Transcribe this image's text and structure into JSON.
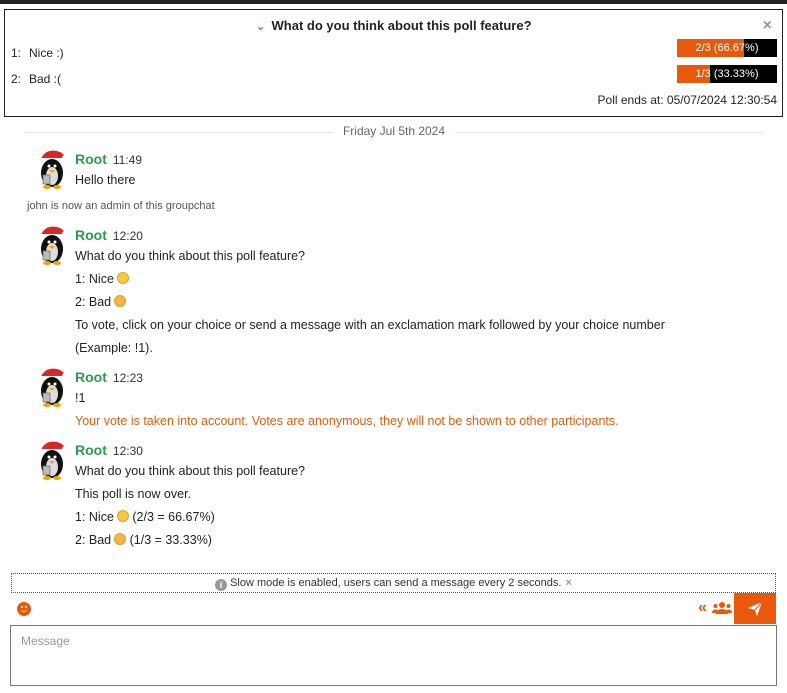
{
  "poll": {
    "question": "What do you think about this poll feature?",
    "choices": [
      {
        "num": "1:",
        "label": "Nice :)",
        "bar_label": "2/3 (66.67%)",
        "fraction": 0.6667
      },
      {
        "num": "2:",
        "label": "Bad :(",
        "bar_label": "1/3 (33.33%)",
        "fraction": 0.3333
      }
    ],
    "ends": "Poll ends at: 05/07/2024 12:30:54",
    "close_glyph": "×"
  },
  "date_separator": "Friday Jul 5th 2024",
  "system_note": "john is now an admin of this groupchat",
  "messages": [
    {
      "author": "Root",
      "time": "11:49",
      "lines": [
        "Hello there"
      ]
    },
    {
      "author": "Root",
      "time": "12:20",
      "lines": [
        "What do you think about this poll feature?",
        "1: Nice",
        "2: Bad",
        "To vote, click on your choice or send a message with an exclamation mark followed by your choice number",
        "(Example: !1)."
      ]
    },
    {
      "author": "Root",
      "time": "12:23",
      "lines": [
        "!1"
      ],
      "notice": "Your vote is taken into account. Votes are anonymous, they will not be shown to other participants."
    },
    {
      "author": "Root",
      "time": "12:30",
      "lines": [
        "What do you think about this poll feature?",
        "This poll is now over.",
        "1: Nice",
        "2: Bad"
      ],
      "results": [
        "(2/3 = 66.67%)",
        "(1/3 = 33.33%)"
      ]
    }
  ],
  "slow_mode": "Slow mode is enabled, users can send a message every 2 seconds.",
  "slow_mode_close": "×",
  "input": {
    "placeholder": "Message"
  },
  "icons": {
    "poll_toggle": "chevron-down-icon",
    "info": "info-icon",
    "emoji_picker": "smiley-icon",
    "rewind": "rewind-icon",
    "participants": "users-icon",
    "send": "paper-plane-icon"
  },
  "colors": {
    "accent": "#e8590c",
    "author": "#2a9d4a",
    "notice": "#e8590c"
  }
}
